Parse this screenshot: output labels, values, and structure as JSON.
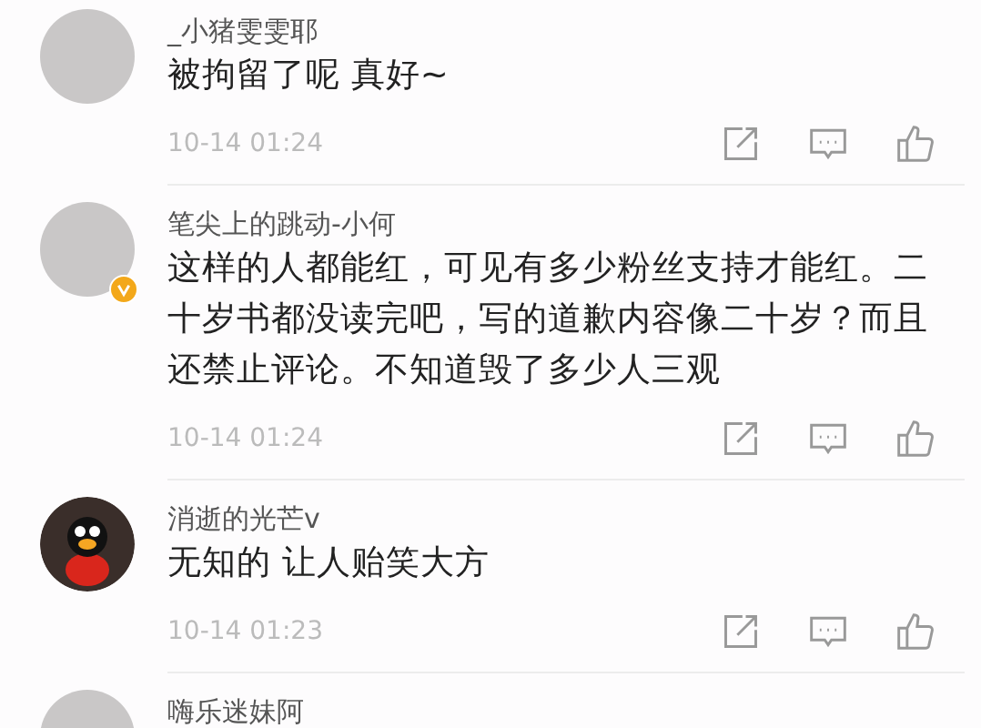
{
  "comments": [
    {
      "name": "_小猪雯雯耶",
      "text": "被拘留了呢 真好~",
      "time": "10-14 01:24",
      "verified": false,
      "kind": "photo"
    },
    {
      "name": "笔尖上的跳动-小何",
      "text": "这样的人都能红，可见有多少粉丝支持才能红。二十岁书都没读完吧，写的道歉内容像二十岁？而且还禁止评论。不知道毁了多少人三观",
      "time": "10-14 01:24",
      "verified": true,
      "kind": "photo"
    },
    {
      "name": "消逝的光芒v",
      "text": "无知的  让人贻笑大方",
      "time": "10-14 01:23",
      "verified": false,
      "kind": "cartoon"
    },
    {
      "name": "嗨乐迷妹阿",
      "kind": "photo"
    }
  ]
}
